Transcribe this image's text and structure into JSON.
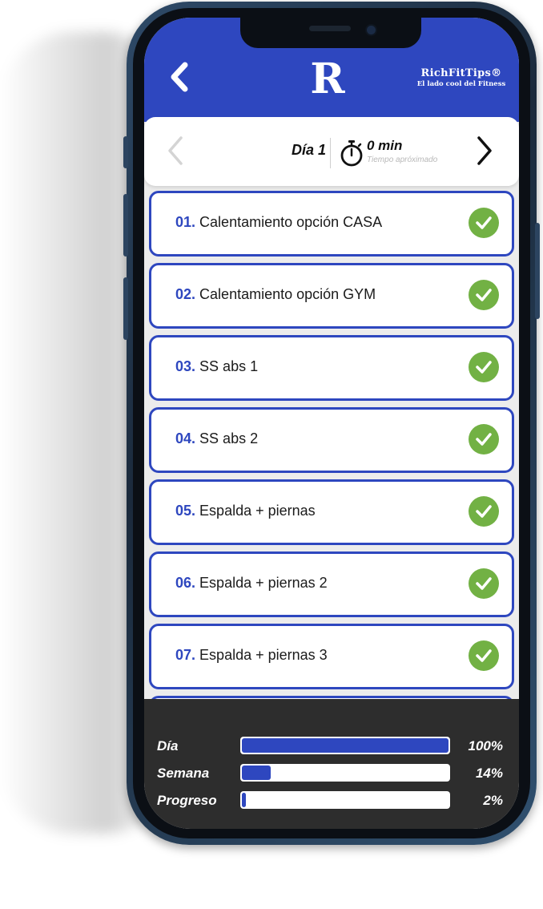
{
  "header": {
    "logo_letter": "R",
    "brand_name": "RichFitTips®",
    "brand_tagline": "El lado cool del Fitness"
  },
  "day_nav": {
    "day_label": "Día 1",
    "time_value": "0 min",
    "time_caption": "Tiempo apróximado"
  },
  "workouts": [
    {
      "num": "01.",
      "title": "Calentamiento opción CASA",
      "completed": true
    },
    {
      "num": "02.",
      "title": "Calentamiento opción GYM",
      "completed": true
    },
    {
      "num": "03.",
      "title": "SS abs 1",
      "completed": true
    },
    {
      "num": "04.",
      "title": "SS abs 2",
      "completed": true
    },
    {
      "num": "05.",
      "title": "Espalda + piernas",
      "completed": true
    },
    {
      "num": "06.",
      "title": "Espalda + piernas 2",
      "completed": true
    },
    {
      "num": "07.",
      "title": "Espalda + piernas 3",
      "completed": true
    }
  ],
  "progress": [
    {
      "label": "Día",
      "value_text": "100%",
      "fraction": 1.0
    },
    {
      "label": "Semana",
      "value_text": "14%",
      "fraction": 0.14
    },
    {
      "label": "Progreso",
      "value_text": "2%",
      "fraction": 0.02
    }
  ],
  "colors": {
    "brand_blue": "#2e47bf",
    "check_green": "#72b144",
    "footer_bg": "#2d2d2d"
  }
}
